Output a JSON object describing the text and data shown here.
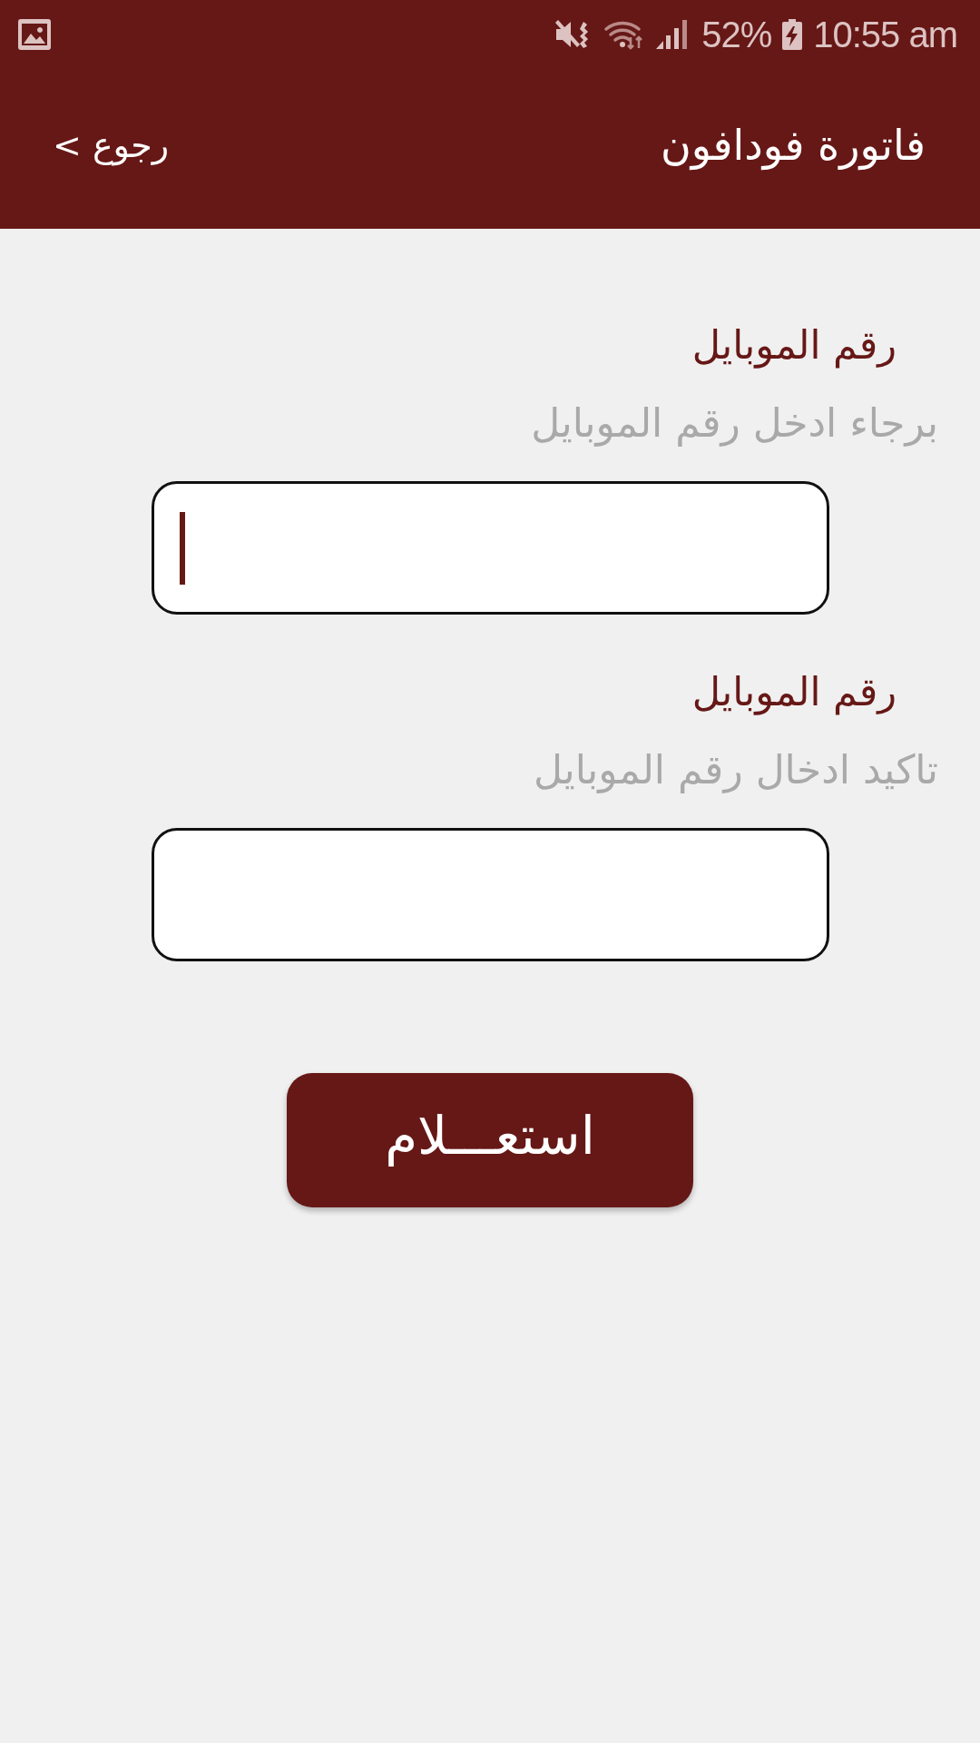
{
  "status_bar": {
    "battery": "52%",
    "time": "10:55 am"
  },
  "header": {
    "back": "رجوع >",
    "title": "فاتورة فودافون"
  },
  "fields": [
    {
      "label": "رقم الموبايل",
      "helper": "برجاء ادخل رقم الموبايل",
      "focused": true
    },
    {
      "label": "رقم الموبايل",
      "helper": "تاكيد ادخال رقم الموبايل",
      "focused": false
    }
  ],
  "submit": {
    "label": "استعـــلام"
  }
}
